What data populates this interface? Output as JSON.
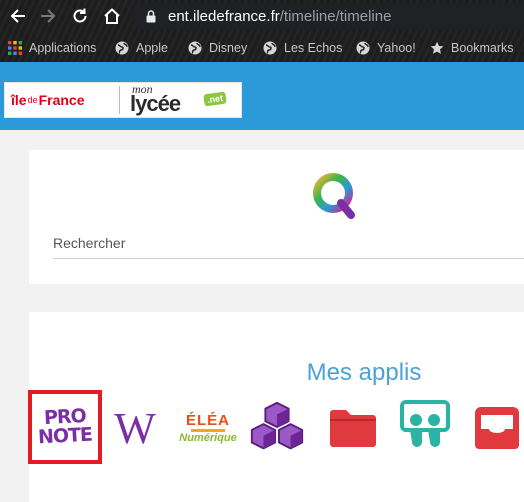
{
  "browser": {
    "url_domain": "ent.iledefrance.fr",
    "url_path": "/timeline/timeline",
    "bookmarks": [
      {
        "label": "Applications",
        "icon": "apps-grid-icon"
      },
      {
        "label": "Apple",
        "icon": "globe-icon"
      },
      {
        "label": "Disney",
        "icon": "globe-icon"
      },
      {
        "label": "Les Echos",
        "icon": "globe-icon"
      },
      {
        "label": "Yahoo!",
        "icon": "globe-icon"
      },
      {
        "label": "Bookmarks",
        "icon": "star-icon"
      }
    ]
  },
  "header": {
    "logo_idf_ile": "île",
    "logo_idf_de": "de",
    "logo_idf_france": "France",
    "logo_lycee_mon": "mon",
    "logo_lycee_main": "lycée",
    "logo_lycee_net": ".net",
    "background": "#2c9ad8"
  },
  "search": {
    "placeholder": "Rechercher"
  },
  "apps": {
    "title": "Mes applis",
    "pronote_line1": "PRO",
    "pronote_line2": "NOTE",
    "wikipedia_letter": "W",
    "elea_top": "ÉLÉA",
    "elea_bottom": "Numérique",
    "items": [
      {
        "name": "Pronote",
        "icon": "pronote-icon",
        "selected": true
      },
      {
        "name": "Wikipedia",
        "icon": "wikipedia-icon"
      },
      {
        "name": "Éléa Numérique",
        "icon": "elea-icon"
      },
      {
        "name": "Blocks",
        "icon": "cubes-icon",
        "color": "#7b2fa7"
      },
      {
        "name": "Folder",
        "icon": "folder-icon",
        "color": "#e03a3e"
      },
      {
        "name": "Slideshare",
        "icon": "slideshare-icon",
        "color": "#2bb3a3"
      },
      {
        "name": "Inbox",
        "icon": "inbox-icon",
        "color": "#e03a3e"
      }
    ],
    "title_color": "#4aa3d6",
    "highlight_color": "#e31b23"
  }
}
